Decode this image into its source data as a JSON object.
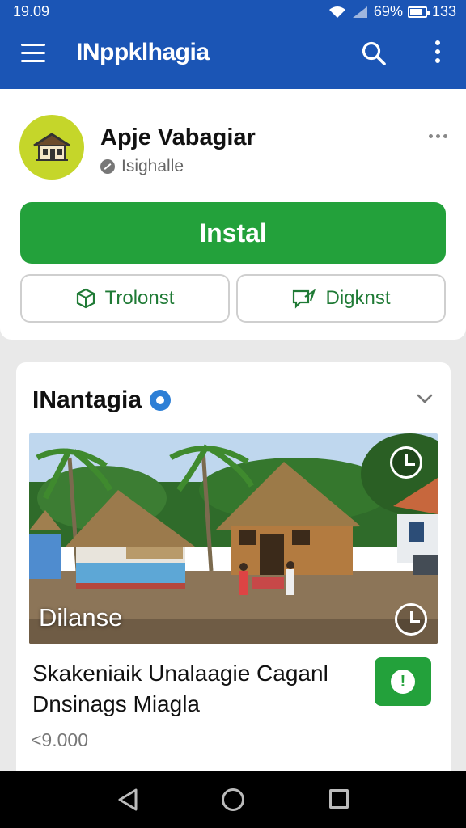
{
  "status_bar": {
    "time": "19.09",
    "battery": "69%",
    "clock_right": "133"
  },
  "app_bar": {
    "title": "INppklhagia"
  },
  "app": {
    "name": "Apje Vabagiar",
    "developer": "Isighalle",
    "install_label": "Instal",
    "button_left_label": "Trolonst",
    "button_right_label": "Digknst"
  },
  "section": {
    "title": "INantagia",
    "photo_caption": "Dilanse",
    "item_title_line1": "Skakeniaik Unalaagie Caganl",
    "item_title_line2": "Dnsinags Miagla",
    "price": "<9.000",
    "action_glyph": "!"
  },
  "colors": {
    "app_bar": "#1b55b5",
    "install": "#23a13b",
    "accent_text": "#1f7a35",
    "app_icon_bg": "#c5d62a"
  }
}
